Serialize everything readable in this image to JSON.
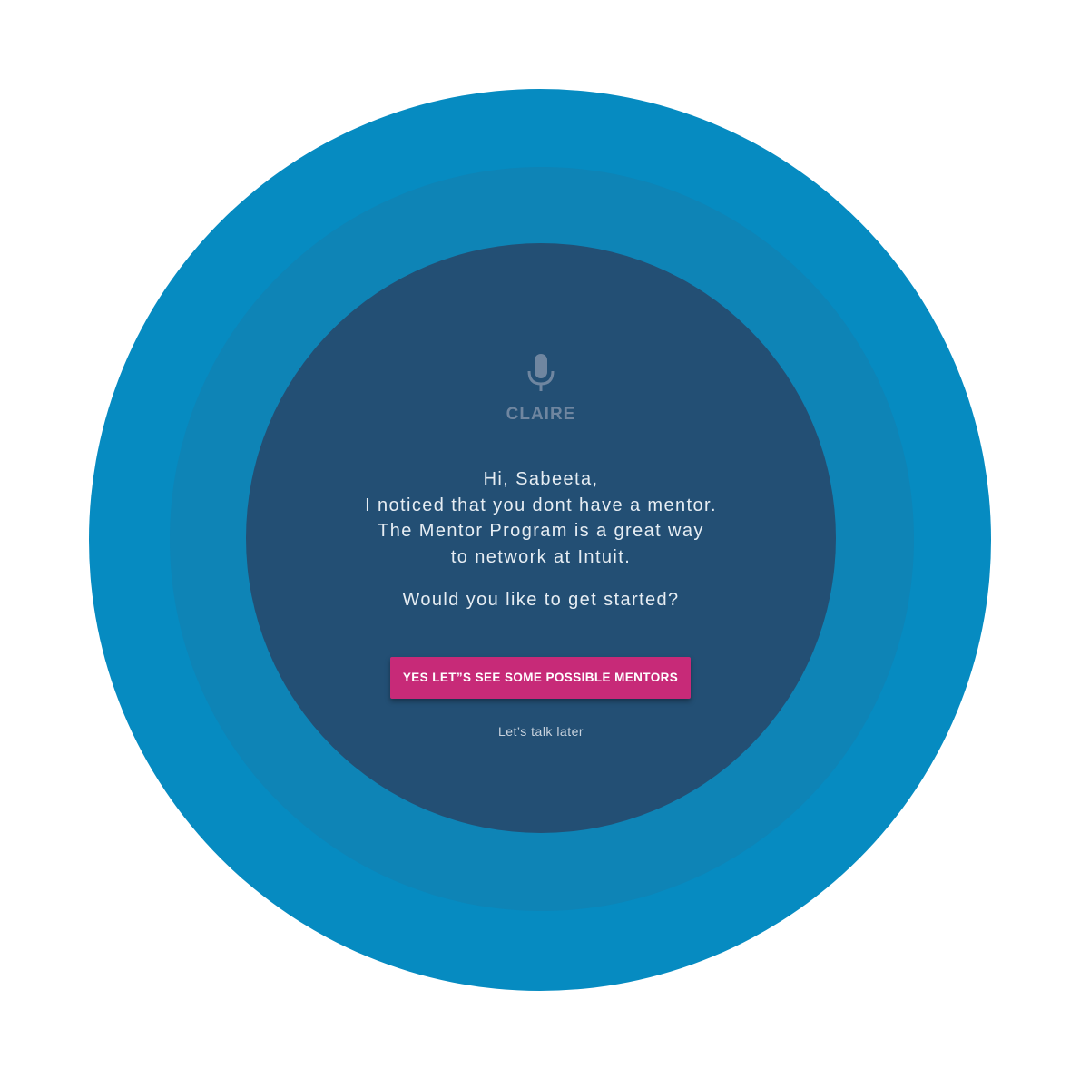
{
  "colors": {
    "outer_ring": "#068bc1",
    "middle_ring": "#0e84b6",
    "inner_circle": "#234f74",
    "button": "#c72a78",
    "assistant_label": "#6f86a0"
  },
  "assistant": {
    "icon": "microphone-icon",
    "name": "CLAIRE"
  },
  "message": {
    "lines": [
      "Hi, Sabeeta,",
      "I noticed that you dont have a mentor.",
      "The Mentor Program is a great way",
      "to network at Intuit."
    ],
    "question": "Would you like to get started?"
  },
  "actions": {
    "primary_label": "YES LET”S SEE SOME POSSIBLE MENTORS",
    "secondary_label": "Let’s talk later"
  }
}
